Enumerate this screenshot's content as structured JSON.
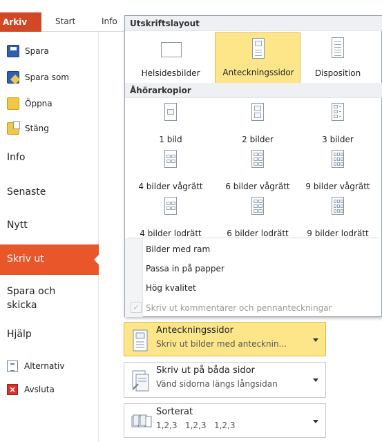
{
  "ribbon": {
    "tabs": {
      "arkiv": "Arkiv",
      "start": "Start",
      "info": "Info"
    }
  },
  "nav": {
    "commands": {
      "save": "Spara",
      "save_as": "Spara som",
      "open": "Öppna",
      "close": "Stäng"
    },
    "tabs": {
      "info": "Info",
      "recent": "Senaste",
      "new": "Nytt",
      "print": "Skriv ut",
      "save_send_1": "Spara och",
      "save_send_2": "skicka",
      "help": "Hjälp"
    },
    "footer": {
      "options": "Alternativ",
      "exit": "Avsluta"
    }
  },
  "dropdown": {
    "print_layout_header": "Utskriftslayout",
    "print_layout": [
      {
        "label": "Helsidesbilder",
        "icon": "full-page-slide-icon"
      },
      {
        "label": "Anteckningssidor",
        "icon": "notes-page-icon",
        "selected": true
      },
      {
        "label": "Disposition",
        "icon": "outline-icon"
      }
    ],
    "handouts_header": "Åhörarkopior",
    "handouts": [
      {
        "label": "1 bild"
      },
      {
        "label": "2 bilder"
      },
      {
        "label": "3 bilder"
      },
      {
        "label": "4 bilder vågrätt"
      },
      {
        "label": "6 bilder vågrätt"
      },
      {
        "label": "9 bilder vågrätt"
      },
      {
        "label": "4 bilder lodrätt"
      },
      {
        "label": "6 bilder lodrätt"
      },
      {
        "label": "9 bilder lodrätt"
      }
    ],
    "options": {
      "frame": "Bilder med ram",
      "fit": "Passa in på papper",
      "quality": "Hög kvalitet",
      "comments": "Skriv ut kommentarer och pennanteckningar"
    }
  },
  "settings": {
    "layout": {
      "title": "Anteckningssidor",
      "desc": "Skriv ut bilder med antecknin..."
    },
    "duplex": {
      "title": "Skriv ut på båda sidor",
      "desc": "Vänd sidorna längs långsidan"
    },
    "collate": {
      "title": "Sorterat",
      "desc": "1,2,3   1,2,3   1,2,3"
    }
  },
  "colors": {
    "accent": "#e8562a",
    "selected": "#fde68a"
  }
}
